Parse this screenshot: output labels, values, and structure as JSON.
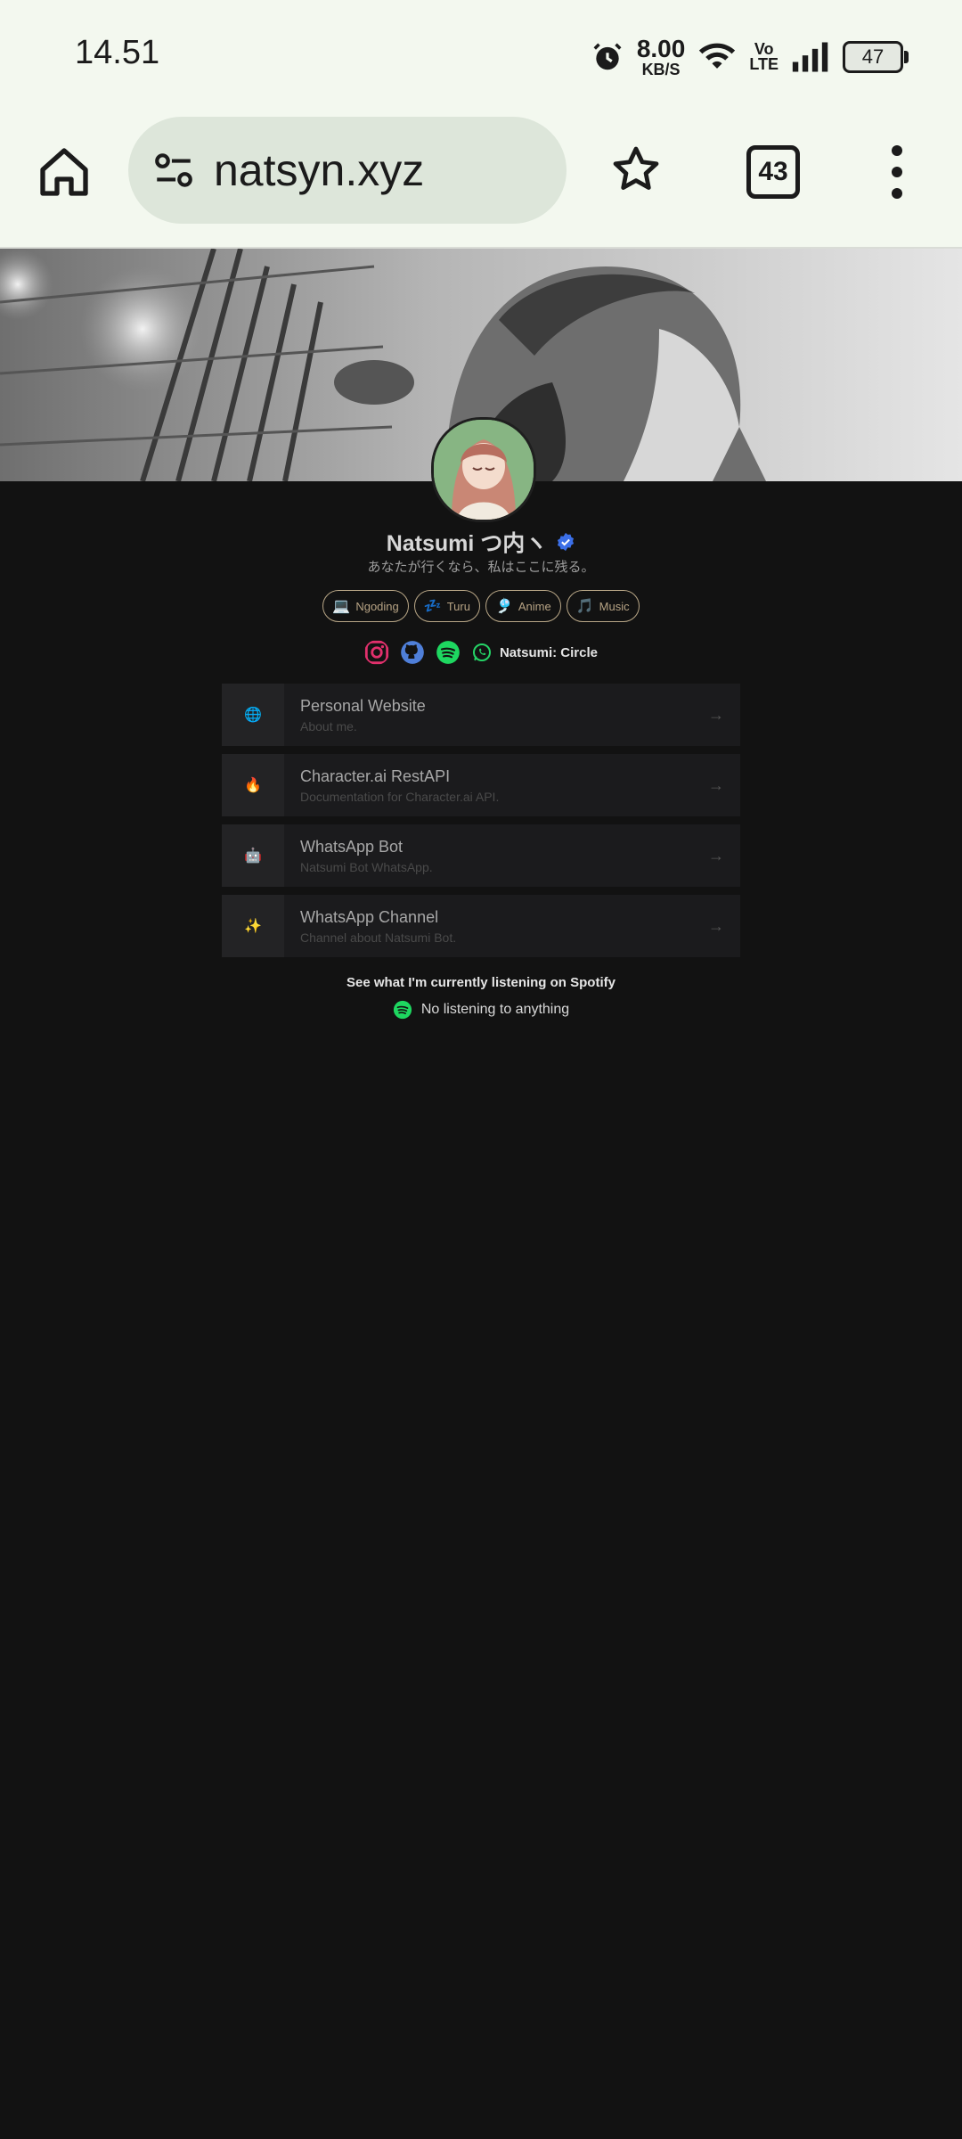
{
  "status_bar": {
    "time": "14.51",
    "net_speed": "8.00",
    "net_unit": "KB/S",
    "volte_top": "Vo",
    "volte_bottom": "LTE",
    "battery": "47"
  },
  "browser": {
    "url": "natsyn.xyz",
    "tab_count": "43"
  },
  "profile": {
    "name": "Natsumi つ内ヽ",
    "bio": "あなたが行くなら、私はここに残る。",
    "tags": [
      {
        "emoji": "💻",
        "label": "Ngoding"
      },
      {
        "emoji": "💤",
        "label": "Turu"
      },
      {
        "emoji": "🎐",
        "label": "Anime"
      },
      {
        "emoji": "🎵",
        "label": "Music"
      }
    ],
    "circle_label": "Natsumi: Circle"
  },
  "links": [
    {
      "icon": "🌐",
      "title": "Personal Website",
      "subtitle": "About me."
    },
    {
      "icon": "🔥",
      "title": "Character.ai RestAPI",
      "subtitle": "Documentation for Character.ai API."
    },
    {
      "icon": "🤖",
      "title": "WhatsApp Bot",
      "subtitle": "Natsumi Bot WhatsApp."
    },
    {
      "icon": "✨",
      "title": "WhatsApp Channel",
      "subtitle": "Channel about Natsumi Bot."
    }
  ],
  "spotify": {
    "heading": "See what I'm currently listening on Spotify",
    "status": "No listening to anything"
  },
  "colors": {
    "accent_verified": "#3b6fe8",
    "spotify_green": "#1ed760",
    "tag_border": "#b9a787"
  }
}
